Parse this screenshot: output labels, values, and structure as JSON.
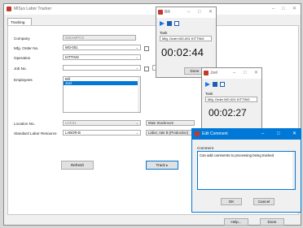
{
  "main_window": {
    "title": "MISys Labor Tracker",
    "tab": "Tracking",
    "fields": {
      "company": {
        "label": "Company",
        "value": "MISAMPCO"
      },
      "mfg_order": {
        "label": "Mfg. Order No.",
        "value": "MO-001"
      },
      "operation": {
        "label": "Operation",
        "value": "KITTING"
      },
      "job_no": {
        "label": "Job No.",
        "value": ""
      },
      "employees": {
        "label": "Employees",
        "items": [
          "Bill",
          "Joel"
        ],
        "selected": "Joel"
      },
      "location": {
        "label": "Location No.",
        "value": "LOC01",
        "description": "Main Stockroom"
      },
      "labor_resource": {
        "label": "Standard Labor Resource",
        "value": "LABOR-B",
        "description": "Labor, rate B (Production)"
      }
    },
    "buttons": {
      "refresh": "Refresh",
      "track": "Track",
      "help": "Help...",
      "done": "Done"
    }
  },
  "bill_timer": {
    "title": "Bill",
    "task_label": "Task",
    "task_value": "Mfg. Order MO-001 KITTING",
    "time": "00:02:44",
    "done": "Done"
  },
  "joel_timer": {
    "title": "Joel",
    "task_label": "Task",
    "task_value": "Mfg. Order MO-001 KITTING",
    "time": "00:02:27"
  },
  "edit_comment": {
    "title": "Edit Comment",
    "comment_label": "Comment",
    "comment_text": "Can add comments to processing being tracked",
    "ok": "OK",
    "cancel": "Cancel",
    "accent": "#0078d7"
  }
}
